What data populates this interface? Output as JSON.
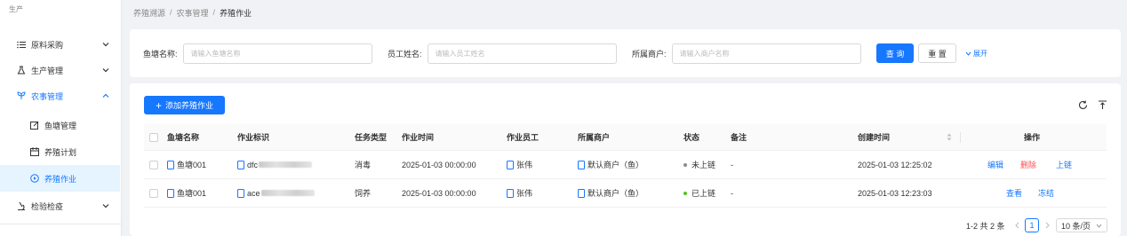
{
  "sidebar": {
    "section_label": "生产",
    "items": [
      {
        "label": "原料采购",
        "icon": "list-icon"
      },
      {
        "label": "生产管理",
        "icon": "flask-icon"
      },
      {
        "label": "农事管理",
        "icon": "sprout-icon"
      },
      {
        "label": "检验检疫",
        "icon": "microscope-icon"
      }
    ],
    "subitems": [
      {
        "label": "鱼塘管理",
        "icon": "edit-icon"
      },
      {
        "label": "养殖计划",
        "icon": "calendar-icon"
      },
      {
        "label": "养殖作业",
        "icon": "circle-play-icon"
      }
    ]
  },
  "breadcrumb": [
    "养殖溯源",
    "农事管理",
    "养殖作业"
  ],
  "search": {
    "pond_label": "鱼塘名称:",
    "pond_placeholder": "请输入鱼塘名称",
    "staff_label": "员工姓名:",
    "staff_placeholder": "请输入员工姓名",
    "merchant_label": "所属商户:",
    "merchant_placeholder": "请输入商户名称",
    "query_label": "查 询",
    "reset_label": "重 置",
    "expand_label": "展开"
  },
  "toolbar": {
    "add_label": "添加养殖作业"
  },
  "table": {
    "columns": [
      "鱼塘名称",
      "作业标识",
      "任务类型",
      "作业时间",
      "作业员工",
      "所属商户",
      "状态",
      "备注",
      "创建时间",
      "操作"
    ],
    "rows": [
      {
        "pond": "鱼塘001",
        "id_prefix": "dfc",
        "task_type": "消毒",
        "time": "2025-01-03 00:00:00",
        "staff": "张伟",
        "merchant": "默认商户（鱼）",
        "status": "未上链",
        "note": "-",
        "created": "2025-01-03 12:25:02",
        "actions": [
          "编辑",
          "删除",
          "上链"
        ]
      },
      {
        "pond": "鱼塘001",
        "id_prefix": "ace",
        "task_type": "饲养",
        "time": "2025-01-03 00:00:00",
        "staff": "张伟",
        "merchant": "默认商户（鱼）",
        "status": "已上链",
        "note": "-",
        "created": "2025-01-03 12:23:03",
        "actions": [
          "查看",
          "冻结"
        ]
      }
    ]
  },
  "pagination": {
    "summary": "1-2 共 2 条",
    "current_page": "1",
    "page_size": "10 条/页"
  },
  "colors": {
    "primary": "#1677ff",
    "danger": "#ff4d4f",
    "success": "#52c41a",
    "muted": "#8c8c8c"
  }
}
